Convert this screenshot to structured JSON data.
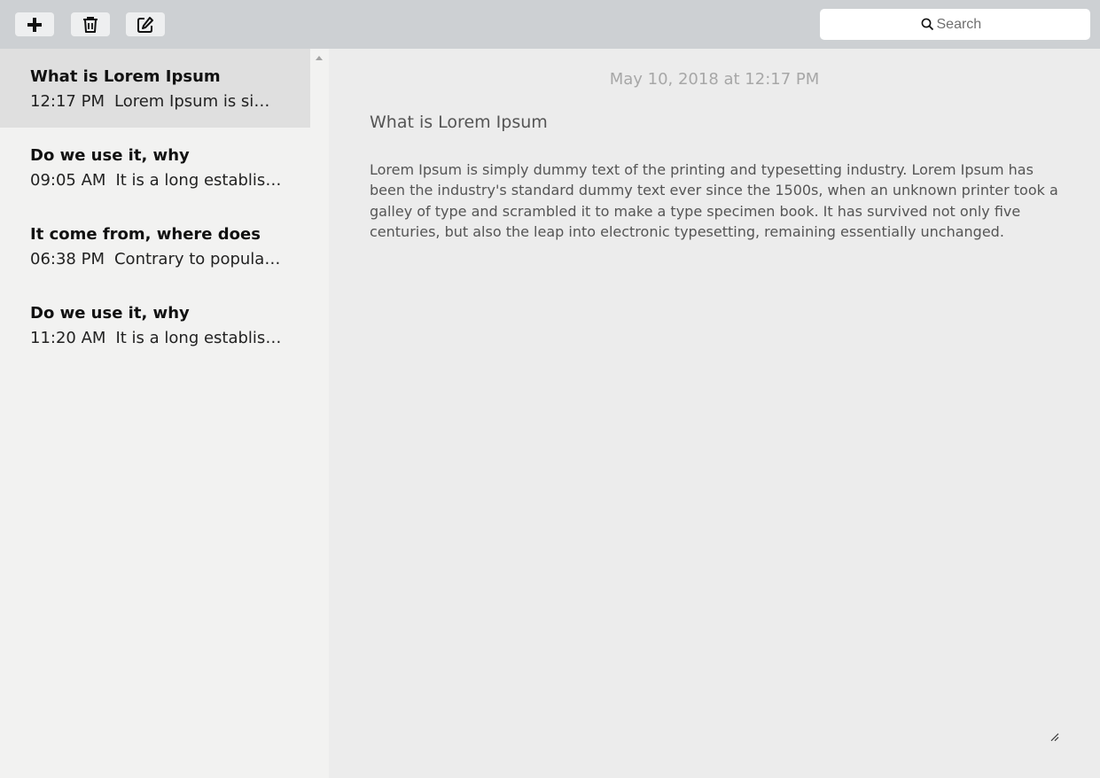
{
  "toolbar": {
    "buttons": [
      {
        "name": "new-note",
        "icon": "plus-icon"
      },
      {
        "name": "delete-note",
        "icon": "trash-icon"
      },
      {
        "name": "edit-note",
        "icon": "compose-icon"
      }
    ],
    "search": {
      "placeholder": "Search",
      "value": "",
      "icon": "search-icon"
    }
  },
  "notes": [
    {
      "title": "What is Lorem Ipsum",
      "time": "12:17 PM",
      "preview": "Lorem Ipsum is simply dummy text of the printing",
      "selected": true
    },
    {
      "title": "Do we use it, why",
      "time": "09:05 AM",
      "preview": "It is a long established fact that a reader",
      "selected": false
    },
    {
      "title": "It come from, where does",
      "time": "06:38 PM",
      "preview": "Contrary to popular belief, Lorem Ipsum",
      "selected": false
    },
    {
      "title": "Do we use it, why",
      "time": "11:20 AM",
      "preview": "It is a long established fact that a reader",
      "selected": false
    }
  ],
  "editor": {
    "date": "May 10, 2018 at 12:17 PM",
    "title": "What is Lorem Ipsum",
    "body": "Lorem Ipsum is simply dummy text of the printing and typesetting industry. Lorem Ipsum has been the industry's standard dummy text ever since the 1500s, when an unknown printer took a galley of type and scrambled it to make a type specimen book. It has survived not only five centuries, but also the leap into electronic typesetting, remaining essentially unchanged."
  },
  "colors": {
    "toolbar_bg": "#cdd0d3",
    "sidebar_bg": "#f2f2f1",
    "selected_bg": "#dfdfdf",
    "editor_bg": "#ececec"
  }
}
